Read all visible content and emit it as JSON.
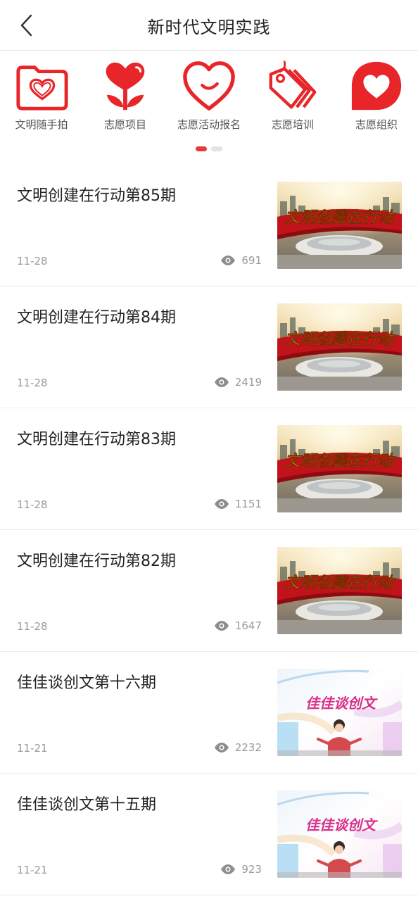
{
  "header": {
    "title": "新时代文明实践"
  },
  "shortcuts": [
    {
      "label": "文明随手拍"
    },
    {
      "label": "志愿项目"
    },
    {
      "label": "志愿活动报名"
    },
    {
      "label": "志愿培训"
    },
    {
      "label": "志愿组织"
    }
  ],
  "carousel": {
    "page": 1,
    "pages": 2
  },
  "colors": {
    "accent": "#e63a3a",
    "icon_red": "#e8262a",
    "text_gray": "#9a9a9a"
  },
  "articles": [
    {
      "title": "文明创建在行动第85期",
      "date": "11-28",
      "views": "691",
      "thumb_text": "文明创建在行动"
    },
    {
      "title": "文明创建在行动第84期",
      "date": "11-28",
      "views": "2419",
      "thumb_text": "文明创建在行动"
    },
    {
      "title": "文明创建在行动第83期",
      "date": "11-28",
      "views": "1151",
      "thumb_text": "文明创建在行动"
    },
    {
      "title": "文明创建在行动第82期",
      "date": "11-28",
      "views": "1647",
      "thumb_text": "文明创建在行动"
    },
    {
      "title": "佳佳谈创文第十六期",
      "date": "11-21",
      "views": "2232",
      "thumb_text": "佳佳谈创文"
    },
    {
      "title": "佳佳谈创文第十五期",
      "date": "11-21",
      "views": "923",
      "thumb_text": "佳佳谈创文"
    }
  ]
}
